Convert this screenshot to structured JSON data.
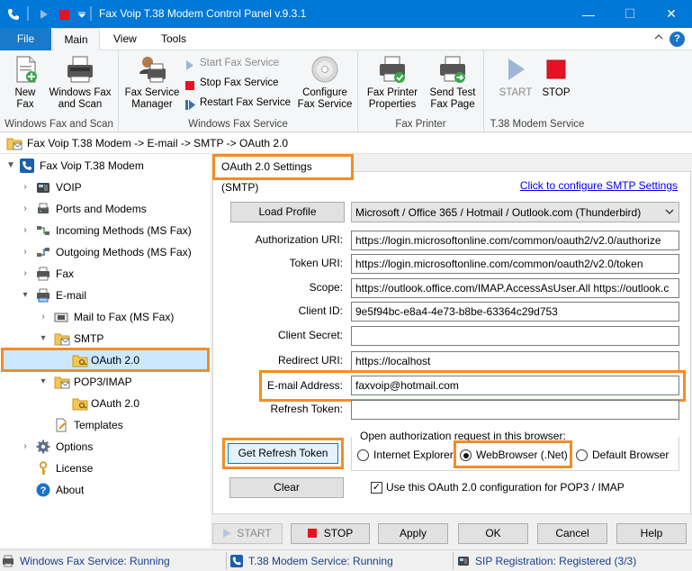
{
  "window": {
    "title": "Fax Voip T.38 Modem Control Panel v.9.3.1",
    "controls": {
      "minimize": "—",
      "maximize": "☐",
      "close": "✕"
    }
  },
  "quick_access": {
    "app_icon": "phone-icon",
    "start": "▶",
    "stop": "■",
    "more": "▾"
  },
  "ribbon_tabs": [
    {
      "label": "File"
    },
    {
      "label": "Main"
    },
    {
      "label": "View"
    },
    {
      "label": "Tools"
    }
  ],
  "ribbon": {
    "groups": {
      "windows_fax": {
        "label": "Windows Fax and Scan",
        "new_fax": "New\nFax",
        "win_fax_scan": "Windows Fax\nand Scan"
      },
      "service": {
        "label": "Windows Fax Service",
        "manager": "Fax Service\nManager",
        "start": "Start Fax Service",
        "stop": "Stop Fax Service",
        "restart": "Restart Fax Service",
        "configure": "Configure\nFax Service"
      },
      "printer": {
        "label": "Fax Printer",
        "properties": "Fax Printer\nProperties",
        "send_test": "Send Test\nFax Page"
      },
      "t38": {
        "label": "T.38 Modem Service",
        "start": "START",
        "stop": "STOP"
      }
    }
  },
  "breadcrumb": "Fax Voip T.38 Modem -> E-mail -> SMTP -> OAuth 2.0",
  "tree": {
    "root": "Fax Voip T.38 Modem",
    "voip": "VOIP",
    "ports": "Ports and Modems",
    "incoming": "Incoming Methods (MS Fax)",
    "outgoing": "Outgoing Methods (MS Fax)",
    "fax": "Fax",
    "email": "E-mail",
    "mail_to_fax": "Mail to Fax (MS Fax)",
    "smtp": "SMTP",
    "smtp_oauth": "OAuth 2.0",
    "pop3": "POP3/IMAP",
    "pop3_oauth": "OAuth 2.0",
    "templates": "Templates",
    "options": "Options",
    "license": "License",
    "about": "About"
  },
  "panel": {
    "header": "OAuth 2.0 Settings (SMTP)",
    "configure_link": "Click to configure SMTP Settings",
    "load_profile": "Load Profile",
    "profile_selected": "Microsoft / Office 365 / Hotmail / Outlook.com (Thunderbird)",
    "fields": {
      "auth_uri": {
        "label": "Authorization URI:",
        "value": "https://login.microsoftonline.com/common/oauth2/v2.0/authorize"
      },
      "token_uri": {
        "label": "Token URI:",
        "value": "https://login.microsoftonline.com/common/oauth2/v2.0/token"
      },
      "scope": {
        "label": "Scope:",
        "value": "https://outlook.office.com/IMAP.AccessAsUser.All https://outlook.c"
      },
      "client_id": {
        "label": "Client ID:",
        "value": "9e5f94bc-e8a4-4e73-b8be-63364c29d753"
      },
      "client_secret": {
        "label": "Client Secret:",
        "value": ""
      },
      "redirect_uri": {
        "label": "Redirect URI:",
        "value": "https://localhost"
      },
      "email": {
        "label": "E-mail Address:",
        "value": "faxvoip@hotmail.com"
      },
      "refresh_token": {
        "label": "Refresh Token:",
        "value": ""
      }
    },
    "browser_group": "Open authorization request in this browser:",
    "browsers": [
      {
        "label": "Internet Explorer",
        "checked": false
      },
      {
        "label": "WebBrowser (.Net)",
        "checked": true
      },
      {
        "label": "Default Browser",
        "checked": false
      }
    ],
    "get_refresh_token": "Get Refresh Token",
    "clear": "Clear",
    "use_for_pop3": {
      "label": "Use this OAuth 2.0 configuration for POP3 / IMAP",
      "checked": true
    }
  },
  "bottom_buttons": {
    "start": "START",
    "stop": "STOP",
    "apply": "Apply",
    "ok": "OK",
    "cancel": "Cancel",
    "help": "Help"
  },
  "status": {
    "fax_service": "Windows Fax Service: Running",
    "t38_service": "T.38 Modem Service: Running",
    "sip": "SIP Registration: Registered (3/3)"
  },
  "colors": {
    "accent": "#0078d7",
    "highlight": "#f28c28",
    "selection": "#cce8ff",
    "link": "#0000ee",
    "stop_red": "#e81123",
    "play_blue": "#7f97b8"
  }
}
